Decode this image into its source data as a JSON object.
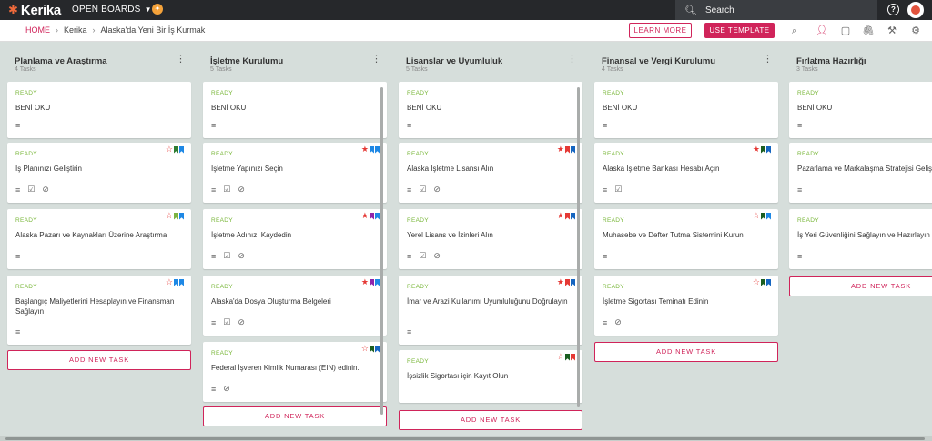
{
  "topbar": {
    "logo_text": "Kerika",
    "open_boards": "OPEN BOARDS",
    "search_placeholder": "Search",
    "help_label": "?"
  },
  "breadcrumb": {
    "home": "HOME",
    "org": "Kerika",
    "board": "Alaska'da Yeni Bir İş Kurmak"
  },
  "actions": {
    "learn_more": "LEARN MORE",
    "use_template": "USE TEMPLATE"
  },
  "columns": [
    {
      "title": "Planlama ve Araştırma",
      "count": "4 Tasks",
      "add_label": "ADD NEW TASK",
      "cards": [
        {
          "status": "READY",
          "title": "BENİ OKU",
          "flags": [],
          "icons": [
            "description"
          ]
        },
        {
          "status": "READY",
          "title": "İş Planınızı Geliştirin",
          "flags": [
            "star-outline",
            "#2e7d32",
            "#1e88e5"
          ],
          "icons": [
            "description",
            "checklist",
            "attachment"
          ]
        },
        {
          "status": "READY",
          "title": "Alaska Pazarı ve Kaynakları Üzerine Araştırma",
          "flags": [
            "star-outline",
            "#7cb342",
            "#1e88e5"
          ],
          "icons": [
            "description"
          ]
        },
        {
          "status": "READY",
          "title": "Başlangıç Maliyetlerini Hesaplayın ve Finansman Sağlayın",
          "flags": [
            "star-outline",
            "#1e88e5",
            "#1e88e5"
          ],
          "icons": [
            "description"
          ]
        }
      ]
    },
    {
      "title": "İşletme Kurulumu",
      "count": "5 Tasks",
      "add_label": "ADD NEW TASK",
      "cards": [
        {
          "status": "READY",
          "title": "BENİ OKU",
          "flags": [],
          "icons": [
            "description"
          ]
        },
        {
          "status": "READY",
          "title": "İşletme Yapınızı Seçin",
          "flags": [
            "star",
            "#1e88e5",
            "#1e88e5"
          ],
          "icons": [
            "description",
            "checklist",
            "attachment"
          ]
        },
        {
          "status": "READY",
          "title": "İşletme Adınızı Kaydedin",
          "flags": [
            "star",
            "#8e24aa",
            "#1e88e5"
          ],
          "icons": [
            "description",
            "checklist",
            "attachment"
          ]
        },
        {
          "status": "READY",
          "title": "Alaska'da Dosya Oluşturma Belgeleri",
          "flags": [
            "star",
            "#8e24aa",
            "#1e88e5"
          ],
          "icons": [
            "description",
            "checklist",
            "attachment"
          ]
        },
        {
          "status": "READY",
          "title": "Federal İşveren Kimlik Numarası (EIN) edinin.",
          "flags": [
            "star-outline",
            "#1b5e20",
            "#1565c0"
          ],
          "icons": [
            "description",
            "attachment"
          ]
        }
      ]
    },
    {
      "title": "Lisanslar ve Uyumluluk",
      "count": "5 Tasks",
      "add_label": "ADD NEW TASK",
      "cards": [
        {
          "status": "READY",
          "title": "BENİ OKU",
          "flags": [],
          "icons": [
            "description"
          ]
        },
        {
          "status": "READY",
          "title": "Alaska İşletme Lisansı Alın",
          "flags": [
            "star",
            "#e53935",
            "#1565c0"
          ],
          "icons": [
            "description",
            "checklist",
            "attachment"
          ]
        },
        {
          "status": "READY",
          "title": "Yerel Lisans ve İzinleri Alın",
          "flags": [
            "star",
            "#e53935",
            "#1565c0"
          ],
          "icons": [
            "description",
            "checklist",
            "attachment"
          ]
        },
        {
          "status": "READY",
          "title": "İmar ve Arazi Kullanımı Uyumluluğunu Doğrulayın",
          "flags": [
            "star",
            "#e53935",
            "#1565c0"
          ],
          "icons": [
            "description"
          ]
        },
        {
          "status": "READY",
          "title": "İşsizlik Sigortası için Kayıt Olun",
          "flags": [
            "star-outline",
            "#1b5e20",
            "#e53935"
          ],
          "icons": []
        }
      ]
    },
    {
      "title": "Finansal ve Vergi Kurulumu",
      "count": "4 Tasks",
      "add_label": "ADD NEW TASK",
      "cards": [
        {
          "status": "READY",
          "title": "BENİ OKU",
          "flags": [],
          "icons": [
            "description"
          ]
        },
        {
          "status": "READY",
          "title": "Alaska İşletme Bankası Hesabı Açın",
          "flags": [
            "star",
            "#1b5e20",
            "#1565c0"
          ],
          "icons": [
            "description",
            "checklist"
          ]
        },
        {
          "status": "READY",
          "title": "Muhasebe ve Defter Tutma Sistemini Kurun",
          "flags": [
            "star-outline",
            "#1b5e20",
            "#1e88e5"
          ],
          "icons": [
            "description"
          ]
        },
        {
          "status": "READY",
          "title": "İşletme Sigortası Teminatı Edinin",
          "flags": [
            "star-outline",
            "#1b5e20",
            "#1565c0"
          ],
          "icons": [
            "description",
            "attachment"
          ]
        }
      ]
    },
    {
      "title": "Fırlatma Hazırlığı",
      "count": "3 Tasks",
      "add_label": "ADD NEW TASK",
      "cards": [
        {
          "status": "READY",
          "title": "BENİ OKU",
          "flags": [],
          "icons": [
            "description"
          ]
        },
        {
          "status": "READY",
          "title": "Pazarlama ve Markalaşma Stratejisi Geliştirin",
          "flags": [],
          "icons": [
            "description"
          ]
        },
        {
          "status": "READY",
          "title": "İş Yeri Güvenliğini Sağlayın ve Hazırlayın",
          "flags": [],
          "icons": [
            "description"
          ]
        }
      ]
    }
  ],
  "colors": {
    "accent": "#d0245a",
    "ready": "#79b73a",
    "star": "#e53935",
    "topbar": "#26282b",
    "board_bg": "#d6dedb"
  }
}
